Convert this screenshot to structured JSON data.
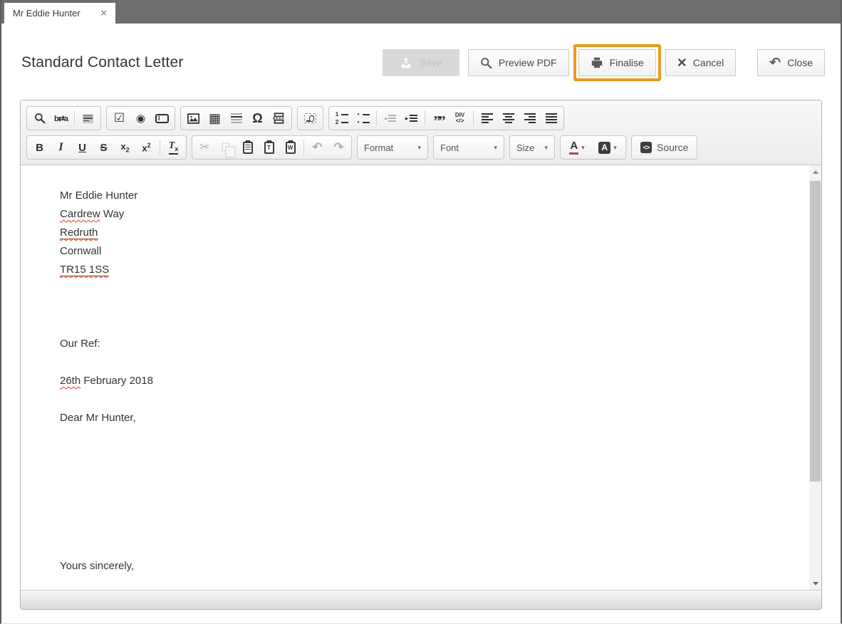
{
  "tab": {
    "label": "Mr Eddie Hunter",
    "close_glyph": "×"
  },
  "page": {
    "title": "Standard Contact Letter"
  },
  "actions": {
    "save": "Save",
    "preview_pdf": "Preview PDF",
    "finalise": "Finalise",
    "cancel": "Cancel",
    "close": "Close"
  },
  "toolbar": {
    "format_dropdown": "Format",
    "font_dropdown": "Font",
    "size_dropdown": "Size",
    "source_button": "Source"
  },
  "icons": {
    "bold": "B",
    "italic": "I",
    "underline": "U",
    "strikethrough": "S",
    "sub_base": "x",
    "sub_mark": "2",
    "sup_base": "x",
    "sup_mark": "2",
    "remove_format_base": "T",
    "remove_format_mark": "x",
    "special_char": "Ω",
    "checkbox": "☑",
    "radio": "◉",
    "table": "▦",
    "blockquote": "””",
    "div_top": "DIV",
    "div_bottom": "</>",
    "cut": "✂",
    "undo": "↶",
    "redo": "↷",
    "close_arrow": "↶",
    "cancel_x": "×",
    "replace": "b⇄a",
    "text_field_letter": "I",
    "paste_text_letter": "T",
    "paste_word_letter": "W",
    "numbered_1": "1",
    "numbered_2": "2",
    "bullet": "•",
    "outdent_tri": "◂",
    "indent_tri": "▸",
    "text_color_letter": "A",
    "bg_color_letter": "A",
    "caret": "▾",
    "source_glyph": "<>"
  },
  "letter": {
    "recipient": "Mr Eddie Hunter",
    "address1_misspelled": "Cardrew",
    "address1_rest": " Way",
    "address2": "Redruth",
    "address3": "Cornwall",
    "postcode": "TR15 1SS",
    "our_ref": "Our Ref:",
    "date_misspelled": "26th",
    "date_rest": " February 2018",
    "salutation": "Dear Mr Hunter,",
    "signoff": "Yours sincerely,"
  },
  "colors": {
    "highlight_box": "#EA9B1E",
    "spellcheck_wavy": "#DD3A2A",
    "tabbar_bg": "#6D6E70"
  }
}
